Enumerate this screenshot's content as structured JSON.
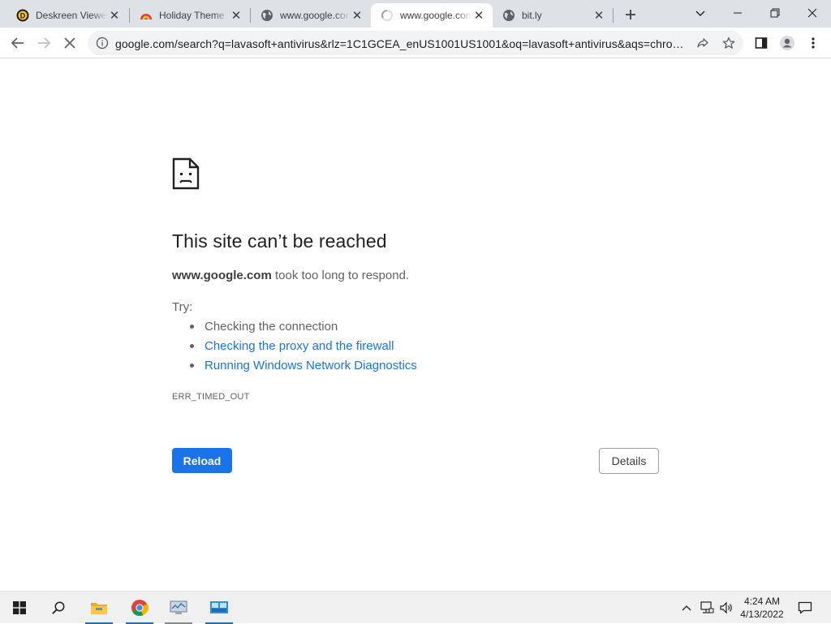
{
  "tabs": [
    {
      "title": "Deskreen Viewer",
      "favicon": "deskreen-icon",
      "active": false
    },
    {
      "title": "Holiday Theme",
      "favicon": "holiday-icon",
      "active": false
    },
    {
      "title": "www.google.com",
      "favicon": "globe-icon",
      "active": false
    },
    {
      "title": "www.google.com",
      "favicon": "loading-spinner-icon",
      "active": true
    },
    {
      "title": "bit.ly",
      "favicon": "globe-icon",
      "active": false
    }
  ],
  "toolbar": {
    "url": "google.com/search?q=lavasoft+antivirus&rlz=1C1GCEA_enUS1001US1001&oq=lavasoft+antivirus&aqs=chrom..."
  },
  "error": {
    "title": "This site can’t be reached",
    "host": "www.google.com",
    "message": " took too long to respond.",
    "try_label": "Try:",
    "suggestions": [
      {
        "text": "Checking the connection",
        "link": false
      },
      {
        "text": "Checking the proxy and the firewall",
        "link": true
      },
      {
        "text": "Running Windows Network Diagnostics",
        "link": true
      }
    ],
    "code": "ERR_TIMED_OUT",
    "reload_label": "Reload",
    "details_label": "Details",
    "link_color": "#1a73e8",
    "button_color": "#1a73e8"
  },
  "taskbar": {
    "apps": [
      "file-explorer-icon",
      "chrome-icon",
      "system-monitor-icon",
      "network-app-icon"
    ],
    "time": "4:24 AM",
    "date": "4/13/2022"
  }
}
